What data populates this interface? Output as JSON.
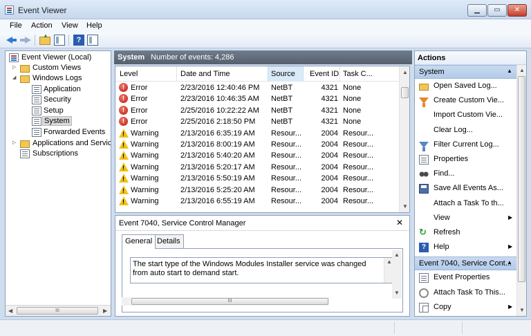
{
  "window": {
    "title": "Event Viewer",
    "minimize_label": "▁",
    "maximize_label": "▭",
    "close_label": "✕"
  },
  "menu": [
    "File",
    "Action",
    "View",
    "Help"
  ],
  "toolbar": {
    "help_label": "?"
  },
  "tree": {
    "items": [
      {
        "label": "Event Viewer (Local)",
        "icon": "event-viewer-icon",
        "twisty": ""
      },
      {
        "label": "Custom Views",
        "icon": "folder-icon",
        "twisty": "▷"
      },
      {
        "label": "Windows Logs",
        "icon": "folder-icon",
        "twisty": "◢"
      },
      {
        "label": "Application",
        "icon": "log-icon",
        "twisty": ""
      },
      {
        "label": "Security",
        "icon": "log-icon",
        "twisty": ""
      },
      {
        "label": "Setup",
        "icon": "log-icon",
        "twisty": ""
      },
      {
        "label": "System",
        "icon": "log-icon",
        "twisty": "",
        "selected": true
      },
      {
        "label": "Forwarded Events",
        "icon": "log-icon",
        "twisty": ""
      },
      {
        "label": "Applications and Service",
        "icon": "folder-icon",
        "twisty": "▷"
      },
      {
        "label": "Subscriptions",
        "icon": "log-icon",
        "twisty": ""
      }
    ],
    "scroll_grip": "III",
    "scroll_left": "◀",
    "scroll_right": "▶"
  },
  "center": {
    "title": "System",
    "count_text": "Number of events: 4,286"
  },
  "grid": {
    "columns": [
      "Level",
      "Date and Time",
      "Source",
      "Event ID",
      "Task C..."
    ],
    "rows": [
      {
        "level": "Error",
        "date": "2/23/2016 12:40:46 PM",
        "source": "NetBT",
        "id": "4321",
        "task": "None"
      },
      {
        "level": "Error",
        "date": "2/23/2016 10:46:35 AM",
        "source": "NetBT",
        "id": "4321",
        "task": "None"
      },
      {
        "level": "Error",
        "date": "2/25/2016 10:22:22 AM",
        "source": "NetBT",
        "id": "4321",
        "task": "None"
      },
      {
        "level": "Error",
        "date": "2/25/2016 2:18:50 PM",
        "source": "NetBT",
        "id": "4321",
        "task": "None"
      },
      {
        "level": "Warning",
        "date": "2/13/2016 6:35:19 AM",
        "source": "Resour...",
        "id": "2004",
        "task": "Resour..."
      },
      {
        "level": "Warning",
        "date": "2/13/2016 8:00:19 AM",
        "source": "Resour...",
        "id": "2004",
        "task": "Resour..."
      },
      {
        "level": "Warning",
        "date": "2/13/2016 5:40:20 AM",
        "source": "Resour...",
        "id": "2004",
        "task": "Resour..."
      },
      {
        "level": "Warning",
        "date": "2/13/2016 5:20:17 AM",
        "source": "Resour...",
        "id": "2004",
        "task": "Resour..."
      },
      {
        "level": "Warning",
        "date": "2/13/2016 5:50:19 AM",
        "source": "Resour...",
        "id": "2004",
        "task": "Resour..."
      },
      {
        "level": "Warning",
        "date": "2/13/2016 5:25:20 AM",
        "source": "Resour...",
        "id": "2004",
        "task": "Resour..."
      },
      {
        "level": "Warning",
        "date": "2/13/2016 6:55:19 AM",
        "source": "Resour...",
        "id": "2004",
        "task": "Resour..."
      }
    ],
    "scroll_up": "▲",
    "scroll_down": "▼"
  },
  "detail": {
    "title": "Event 7040, Service Control Manager",
    "close_label": "✕",
    "tabs": [
      "General",
      "Details"
    ],
    "description": "The start type of the Windows Modules Installer service was changed from auto start to demand start.",
    "scroll_grip": "III",
    "scroll_up": "▲",
    "scroll_down": "▼"
  },
  "actions": {
    "title": "Actions",
    "sections": [
      {
        "header": "System",
        "items": [
          {
            "label": "Open Saved Log...",
            "icon": "open-folder-icon",
            "submenu": false
          },
          {
            "label": "Create Custom Vie...",
            "icon": "filter-create-icon",
            "submenu": false
          },
          {
            "label": "Import Custom Vie...",
            "icon": "",
            "submenu": false
          },
          {
            "label": "Clear Log...",
            "icon": "",
            "submenu": false
          },
          {
            "label": "Filter Current Log...",
            "icon": "filter-icon",
            "submenu": false
          },
          {
            "label": "Properties",
            "icon": "properties-icon",
            "submenu": false
          },
          {
            "label": "Find...",
            "icon": "binoculars-icon",
            "submenu": false
          },
          {
            "label": "Save All Events As...",
            "icon": "save-icon",
            "submenu": false
          },
          {
            "label": "Attach a Task To th...",
            "icon": "",
            "submenu": false
          },
          {
            "label": "View",
            "icon": "",
            "submenu": true
          },
          {
            "label": "Refresh",
            "icon": "refresh-icon",
            "submenu": false
          },
          {
            "label": "Help",
            "icon": "help-icon",
            "submenu": true
          }
        ]
      },
      {
        "header": "Event 7040, Service Cont...",
        "items": [
          {
            "label": "Event Properties",
            "icon": "properties-icon",
            "submenu": false
          },
          {
            "label": "Attach Task To This...",
            "icon": "task-icon",
            "submenu": false
          },
          {
            "label": "Copy",
            "icon": "copy-icon",
            "submenu": true
          }
        ]
      }
    ],
    "collapse_caret": "▲",
    "submenu_arrow": "▶",
    "scroll_up": "▲",
    "scroll_down": "▼"
  },
  "colors": {
    "frame": "#cfdeef",
    "pane_header": "#5f6b7a",
    "section_header": "#bcd1ec",
    "error": "#c8231a",
    "warning": "#f2c318"
  }
}
